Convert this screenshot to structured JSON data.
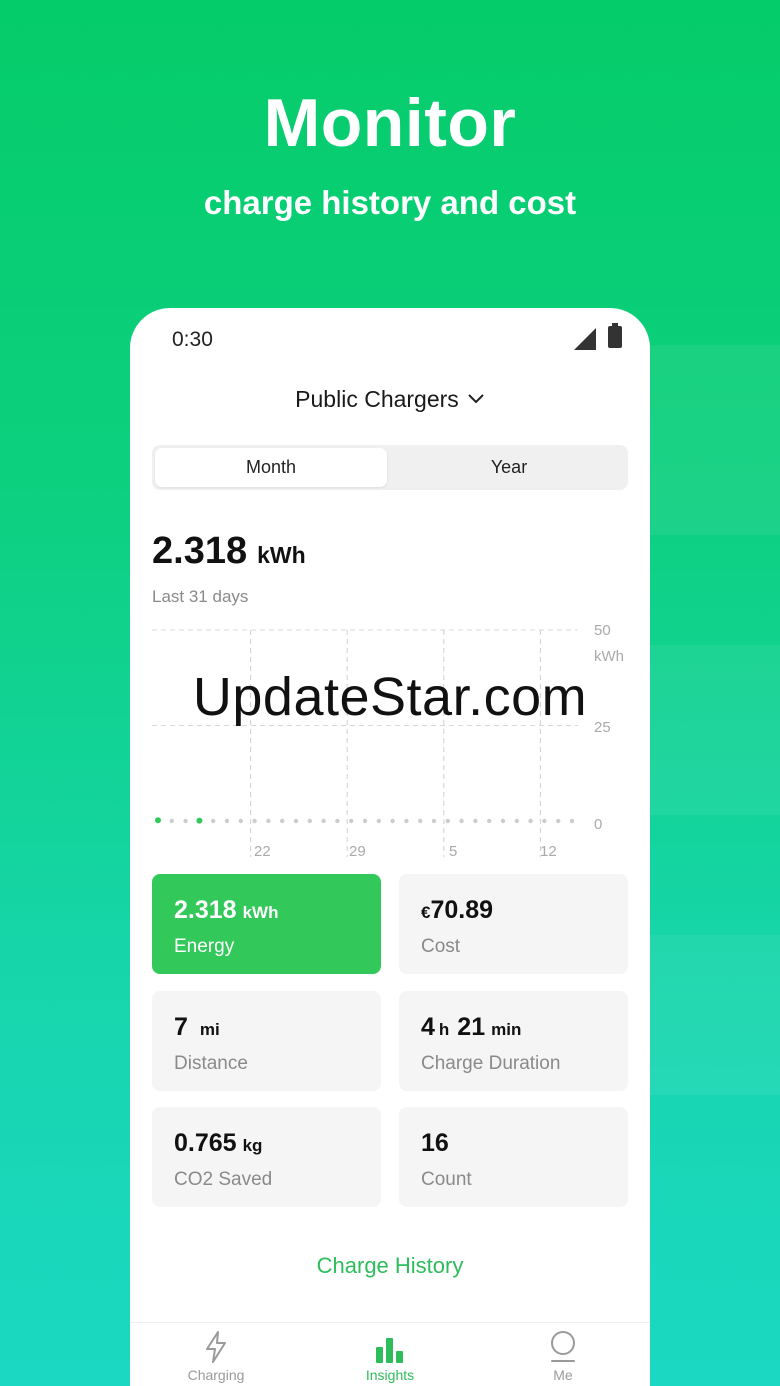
{
  "hero": {
    "title": "Monitor",
    "subtitle": "charge history and cost"
  },
  "status": {
    "time": "0:30"
  },
  "header": {
    "selector_label": "Public Chargers"
  },
  "period_toggle": {
    "options": [
      "Month",
      "Year"
    ],
    "selected": "Month"
  },
  "summary": {
    "value": "2.318",
    "unit": "kWh",
    "period": "Last 31 days"
  },
  "chart_data": {
    "type": "scatter",
    "ylabel": "kWh",
    "ylim": [
      0,
      50
    ],
    "y_ticks": [
      "50",
      "25",
      "0"
    ],
    "x_ticks": [
      "22",
      "29",
      "5",
      "12"
    ],
    "highlighted_points": 2,
    "total_points": 31,
    "values": [
      0.2,
      0,
      0,
      0.1,
      0,
      0,
      0,
      0,
      0,
      0,
      0,
      0,
      0,
      0,
      0,
      0,
      0,
      0,
      0,
      0,
      0,
      0,
      0,
      0,
      0,
      0,
      0,
      0,
      0,
      0,
      0
    ],
    "colors": {
      "active": "#33c85a",
      "empty": "#cccccc"
    }
  },
  "watermark": "UpdateStar.com",
  "stats": {
    "energy": {
      "value": "2.318",
      "unit": "kWh",
      "label": "Energy"
    },
    "cost": {
      "currency": "€",
      "value": "70.89",
      "label": "Cost"
    },
    "distance": {
      "value": "7",
      "unit": "mi",
      "label": "Distance"
    },
    "duration": {
      "hours": "4",
      "h_unit": "h",
      "minutes": "21",
      "m_unit": "min",
      "label": "Charge Duration"
    },
    "co2": {
      "value": "0.765",
      "unit": "kg",
      "label": "CO2 Saved"
    },
    "count": {
      "value": "16",
      "label": "Count"
    }
  },
  "history_link": "Charge History",
  "tabs": [
    {
      "label": "Charging",
      "icon": "lightning-icon"
    },
    {
      "label": "Insights",
      "icon": "bar-chart-icon"
    },
    {
      "label": "Me",
      "icon": "profile-icon"
    }
  ],
  "colors": {
    "brand": "#05cc6a",
    "accent": "#33c85a",
    "link": "#2dbd5b"
  }
}
